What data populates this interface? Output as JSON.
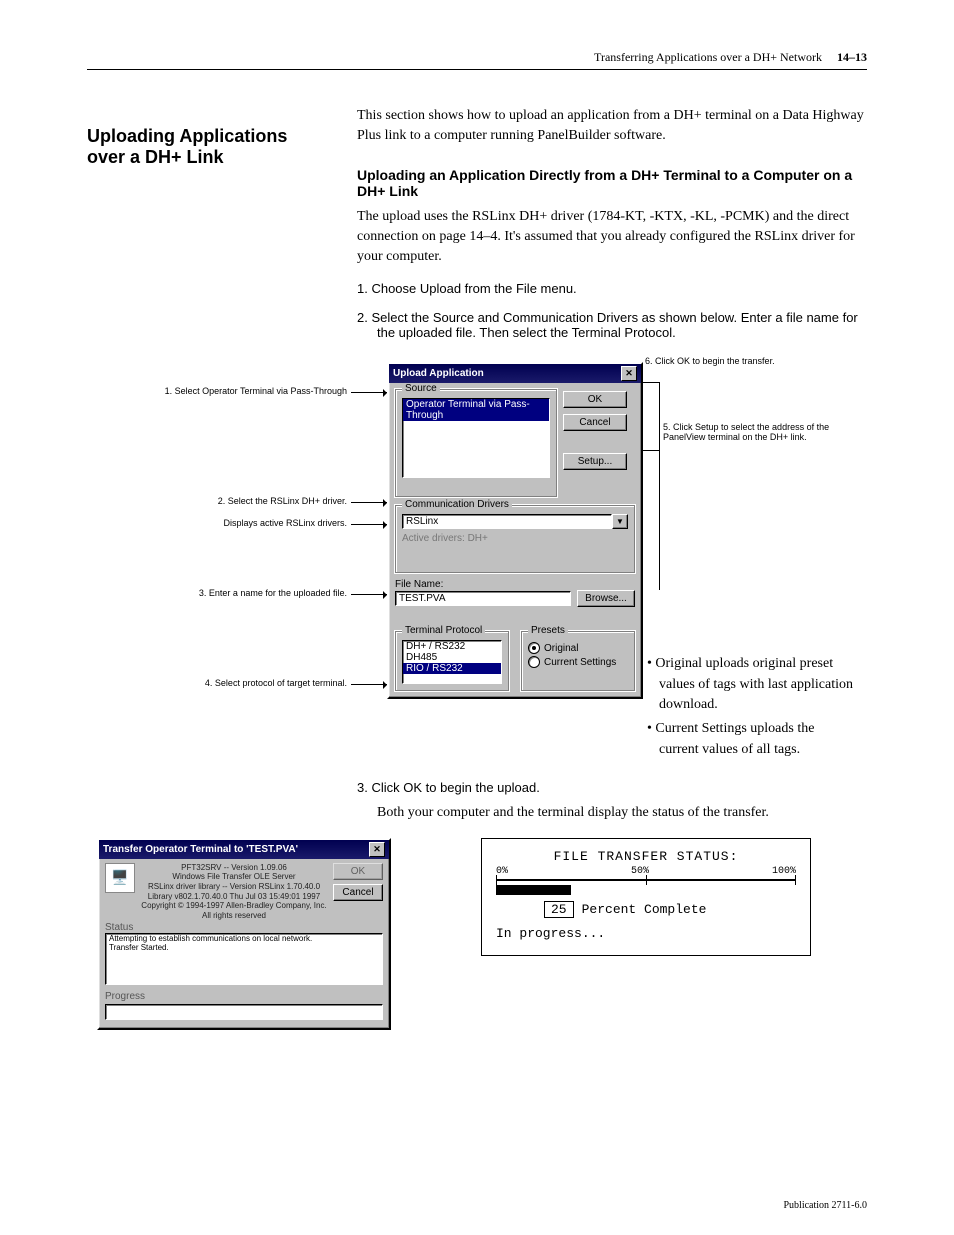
{
  "running_head": {
    "left": "",
    "right": "Transferring Applications over a DH+ Network",
    "page_no": "14–13"
  },
  "section": {
    "title": "Uploading Applications over a DH+ Link",
    "intro": "This section shows how to upload an application from a DH+ terminal on a Data Highway Plus link to a computer running PanelBuilder software.",
    "sub": "Uploading an Application Directly from a DH+ Terminal to a Computer on a DH+ Link",
    "sub_after": "The upload uses the RSLinx DH+ driver (1784-KT, -KTX, -KL, -PCMK) and the direct connection on page 14–4. It's assumed that you already configured the RSLinx driver for your computer.",
    "steps": {
      "s1": "1.  Choose Upload from the File menu.",
      "s2": "2.  Select the Source and Communication Drivers as shown below. Enter a file name for the uploaded file. Then select the Terminal Protocol.",
      "s3": "3.  Click OK to begin the upload.",
      "s3_after": "Both your computer and the terminal display the status of the transfer."
    },
    "bullets": {
      "b1": "Original uploads original preset values of tags with last application download.",
      "b2": "Current Settings uploads the current values of all tags."
    }
  },
  "callouts": {
    "c1": "1. Select Operator Terminal via Pass-Through",
    "c2": "2. Select the RSLinx DH+ driver.",
    "c3": "Displays active RSLinx drivers.",
    "c4": "3. Enter a name for the uploaded file.",
    "c5": "4. Select protocol of target terminal.",
    "c6": "5. Click Setup to select the address of the PanelView terminal on the DH+ link.",
    "c7": "6. Click OK to begin the transfer."
  },
  "upload_dialog": {
    "title": "Upload Application",
    "close_x": "✕",
    "buttons": {
      "ok": "OK",
      "cancel": "Cancel",
      "setup": "Setup...",
      "browse": "Browse..."
    },
    "groups": {
      "source": "Source",
      "comm": "Communication Drivers",
      "filename_lbl": "File Name:",
      "protocol": "Terminal Protocol",
      "presets": "Presets"
    },
    "source_list": {
      "selected": "Operator Terminal via Pass-Through"
    },
    "comm": {
      "driver": "RSLinx",
      "active": "Active drivers: DH+"
    },
    "file_name": "TEST.PVA",
    "protocol_list": [
      "DH+ / RS232",
      "DH485",
      "RIO / RS232"
    ],
    "protocol_sel_index": 2,
    "presets": {
      "original": "Original",
      "current": "Current Settings"
    }
  },
  "transfer_dialog": {
    "title": "Transfer Operator Terminal to 'TEST.PVA'",
    "ok": "OK",
    "cancel": "Cancel",
    "lines": [
      "PFT32SRV -- Version  1.09.06",
      "Windows File Transfer OLE Server",
      "RSLinx driver library -- Version RSLinx 1.70.40.0",
      "Library     v802.1.70.40.0 Thu Jul 03 15:49:01 1997",
      "",
      "Copyright © 1994-1997 Allen-Bradley Company, Inc.",
      "All rights reserved"
    ],
    "status_label": "Status",
    "status_lines": [
      "Attempting to establish communications on local network.",
      "Transfer Started."
    ],
    "progress_label": "Progress"
  },
  "lcd": {
    "title": "FILE TRANSFER STATUS:",
    "ticks": {
      "t0": "0%",
      "t50": "50%",
      "t100": "100%"
    },
    "percent_box": "25",
    "percent_label": "Percent Complete",
    "status": "In progress..."
  },
  "footer": {
    "pub": "Publication 2711-6.0"
  }
}
